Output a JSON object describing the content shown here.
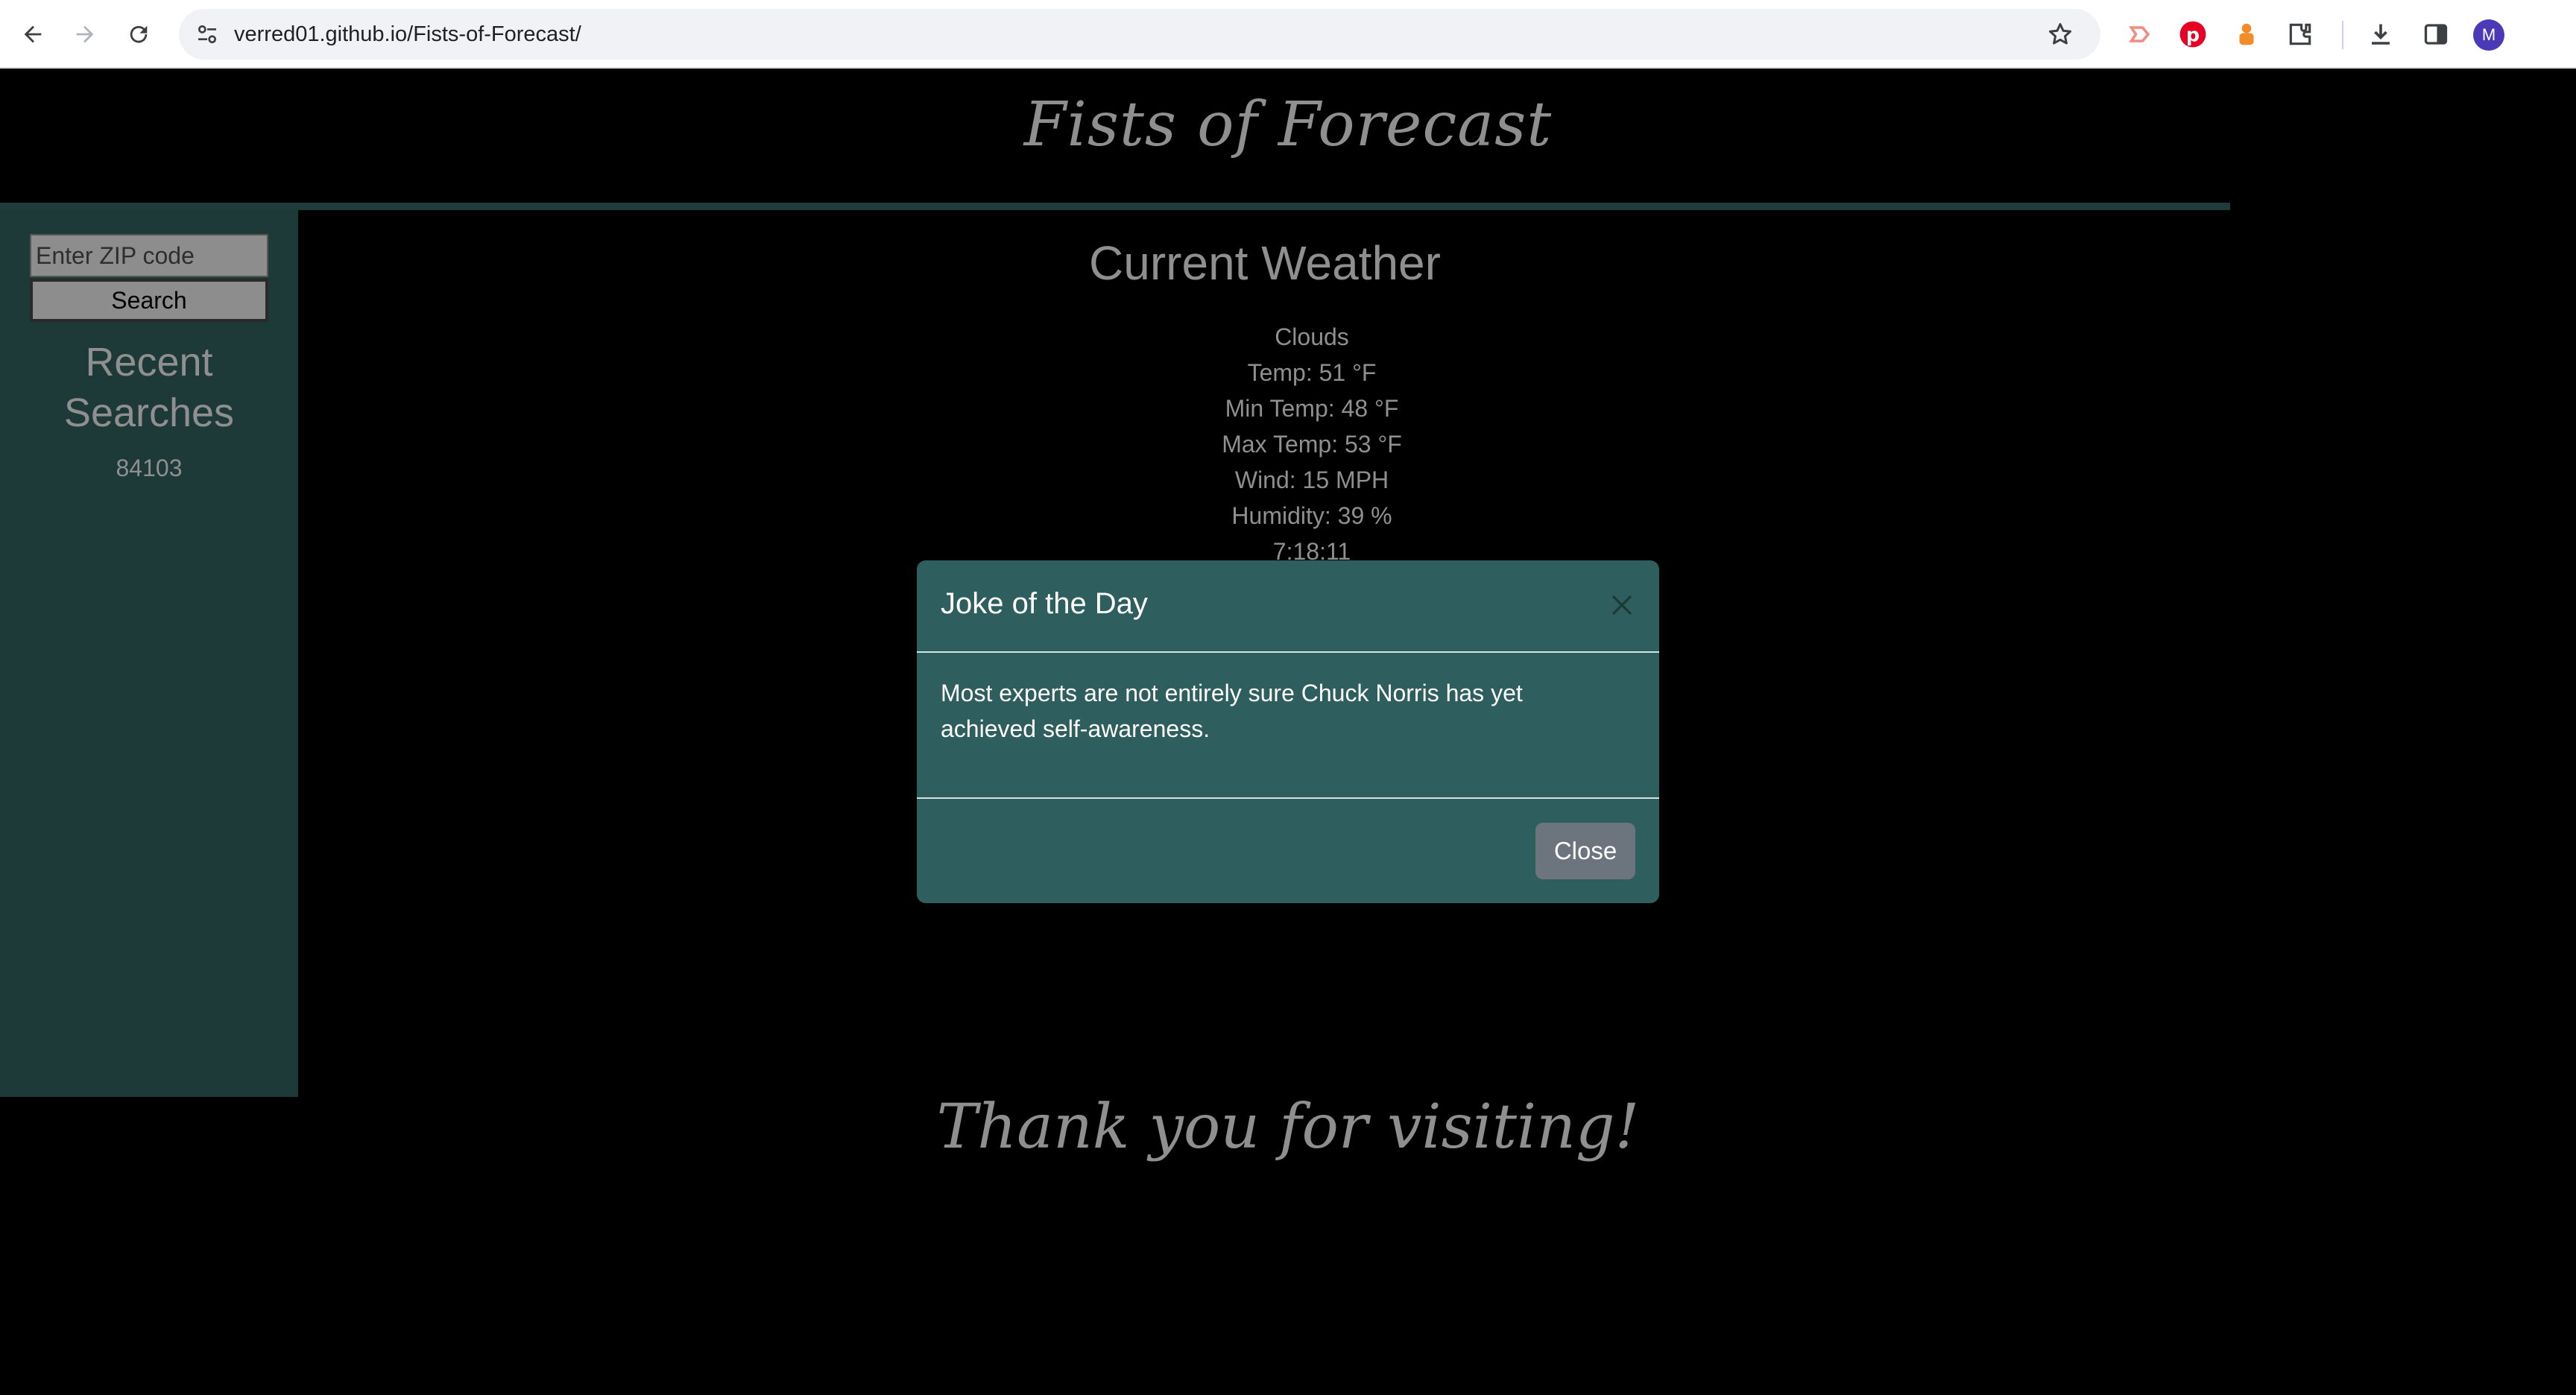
{
  "browser": {
    "url_host": "verred01.github.io",
    "url_path": "/Fists-of-Forecast/",
    "avatar_letter": "M",
    "icons": [
      "back-arrow-icon",
      "forward-arrow-icon",
      "reload-icon",
      "site-settings-icon",
      "bookmark-star-icon",
      "extension-cast-icon",
      "pinterest-icon",
      "extension-puzzle-icon",
      "extension-icon",
      "download-icon",
      "side-panel-icon"
    ]
  },
  "page": {
    "title": "Fists of Forecast",
    "footer": "Thank you for visiting!"
  },
  "sidebar": {
    "zip_placeholder": "Enter ZIP code",
    "search_label": "Search",
    "recent_title": "Recent Searches",
    "recent_items": [
      "84103"
    ]
  },
  "weather": {
    "title": "Current Weather",
    "condition": "Clouds",
    "temp": "Temp: 51 °F",
    "min_temp": "Min Temp: 48 °F",
    "max_temp": "Max Temp: 53 °F",
    "wind": "Wind: 15 MPH",
    "humidity": "Humidity: 39 %",
    "time": "7:18:11"
  },
  "modal": {
    "title": "Joke of the Day",
    "body": "Most experts are not entirely sure Chuck Norris has yet achieved self-awareness.",
    "close_label": "Close"
  },
  "colors": {
    "background": "#000000",
    "sidebar": "#1e3a38",
    "modal": "#2e5e5e",
    "text_gray": "#8f8f8f",
    "close_button": "#6c757d"
  }
}
